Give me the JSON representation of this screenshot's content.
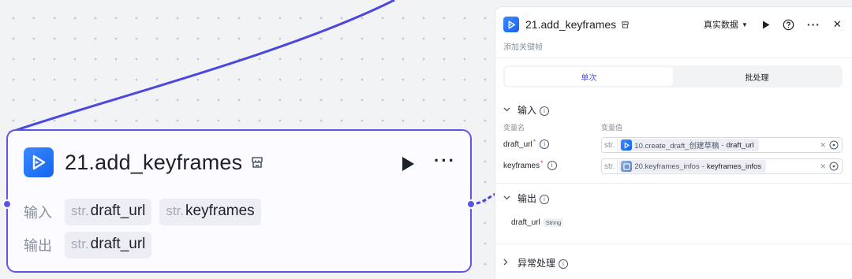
{
  "node": {
    "title": "21.add_keyframes",
    "input_label": "输入",
    "output_label": "输出",
    "inputs": [
      {
        "type": "str.",
        "name": "draft_url"
      },
      {
        "type": "str.",
        "name": "keyframes"
      }
    ],
    "outputs": [
      {
        "type": "str.",
        "name": "draft_url"
      }
    ],
    "more": "···"
  },
  "panel": {
    "title": "21.add_keyframes",
    "description": "添加关键帧",
    "data_mode": "真实数据",
    "more": "···",
    "close": "✕",
    "tabs": [
      {
        "label": "单次",
        "active": true
      },
      {
        "label": "批处理",
        "active": false
      }
    ],
    "input_section": {
      "title": "输入",
      "col_name": "变量名",
      "col_value": "变量值",
      "params": [
        {
          "name": "draft_url",
          "required": "*",
          "type": "str.",
          "ref_node": "10.create_draft_创建草稿",
          "separator": "-",
          "ref_var": "draft_url"
        },
        {
          "name": "keyframes",
          "required": "*",
          "type": "str.",
          "ref_node": "20.keyframes_infos",
          "separator": "-",
          "ref_var": "keyframes_infos"
        }
      ]
    },
    "output_section": {
      "title": "输出",
      "outputs": [
        {
          "name": "draft_url",
          "type": "String"
        }
      ]
    },
    "error_section": {
      "title": "异常处理"
    }
  },
  "colors": {
    "accent": "#5d57e6",
    "node_icon": "#1e6ff5",
    "edge": "#4b48de",
    "tab_active_text": "#4d53e8"
  },
  "icons": {
    "node_icon": "play-video-icon",
    "store_icon": "store-icon",
    "run_icon": "play-icon",
    "help_icon": "question-circle-icon",
    "close_icon": "close-icon",
    "target_icon": "target-icon"
  }
}
